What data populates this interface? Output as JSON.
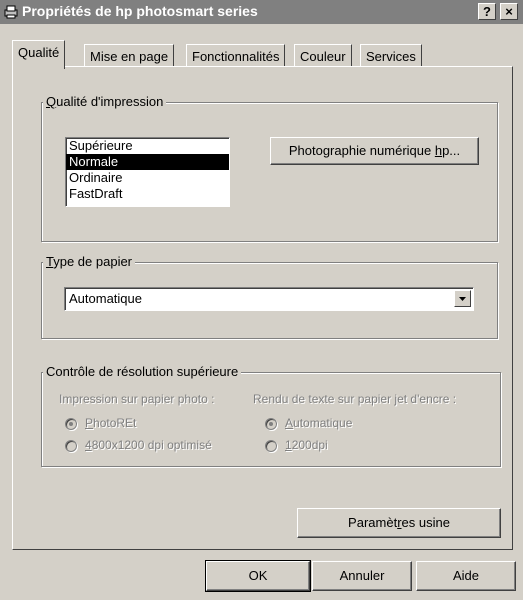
{
  "window": {
    "title": "Propriétés de hp photosmart series",
    "help_button": "?",
    "close_button": "×"
  },
  "tabs": [
    {
      "label": "Qualité",
      "active": true
    },
    {
      "label": "Mise en page",
      "active": false
    },
    {
      "label": "Fonctionnalités",
      "active": false
    },
    {
      "label": "Couleur",
      "active": false
    },
    {
      "label": "Services",
      "active": false
    }
  ],
  "print_quality": {
    "legend_prefix": "Q",
    "legend_rest": "ualité d'impression",
    "options": [
      "Supérieure",
      "Normale",
      "Ordinaire",
      "FastDraft"
    ],
    "selected": "Normale",
    "photo_button_prefix": "Photographie numérique ",
    "photo_button_accel": "h",
    "photo_button_suffix": "p..."
  },
  "paper_type": {
    "legend_prefix": "T",
    "legend_rest": "ype de papier",
    "value": "Automatique"
  },
  "resolution": {
    "legend": "Contrôle de résolution supérieure",
    "photo_paper_label": "Impression sur papier photo :",
    "inkjet_label": "Rendu de texte sur papier jet d'encre :",
    "photo_options": [
      {
        "accel": "P",
        "rest": "hotoREt",
        "checked": true
      },
      {
        "accel": "4",
        "rest": "800x1200 dpi optimisé",
        "checked": false
      }
    ],
    "inkjet_options": [
      {
        "accel": "A",
        "rest": "utomatique",
        "checked": true
      },
      {
        "accel": "1",
        "rest": "200dpi",
        "checked": false
      }
    ]
  },
  "factory_button": {
    "prefix": "Paramèt",
    "accel": "r",
    "suffix": "es usine"
  },
  "footer": {
    "ok": "OK",
    "cancel": "Annuler",
    "help": "Aide"
  },
  "colors": {
    "titlebar": "#808080",
    "face": "#d4d0c8",
    "selection": "#000000"
  }
}
